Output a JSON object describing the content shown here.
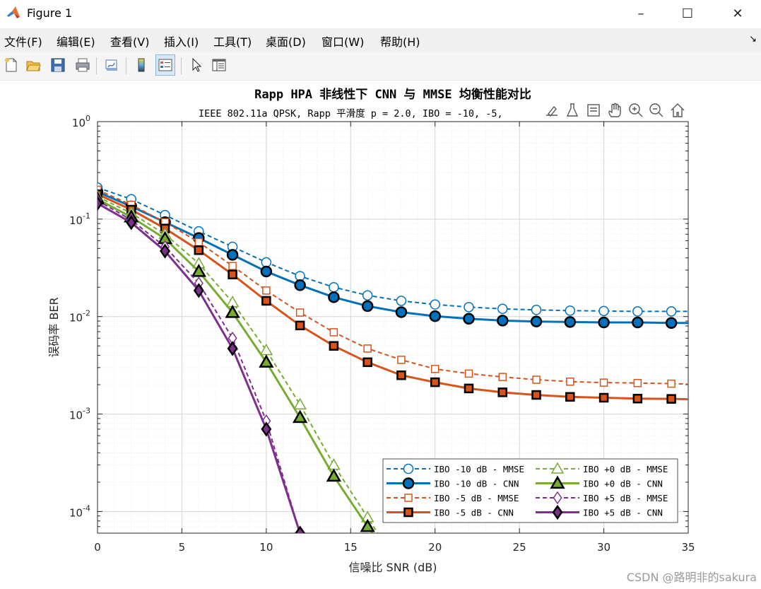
{
  "window": {
    "title": "Figure 1",
    "minimize": "–",
    "maximize": "☐",
    "close": "✕"
  },
  "menu": [
    "文件(F)",
    "编辑(E)",
    "查看(V)",
    "插入(I)",
    "工具(T)",
    "桌面(D)",
    "窗口(W)",
    "帮助(H)"
  ],
  "menu_corner": "↘",
  "toolbar_icons": [
    "new-figure-icon",
    "open-file-icon",
    "save-icon",
    "print-icon",
    "link-plot-icon",
    "colorbar-icon",
    "legend-icon",
    "pointer-icon",
    "property-inspector-icon"
  ],
  "axes_toolbar_icons": [
    "brush-icon",
    "data-tips-icon",
    "datatip-cursor-icon",
    "pan-icon",
    "zoom-in-icon",
    "zoom-out-icon",
    "home-icon"
  ],
  "watermark": "CSDN @路明非的sakura",
  "colors": {
    "blue": "#0072bd",
    "orange": "#d95319",
    "green": "#77ac30",
    "purple": "#7e2f8e"
  },
  "chart_data": {
    "type": "line",
    "title": "Rapp HPA 非线性下 CNN 与 MMSE 均衡性能对比",
    "subtitle": "IEEE 802.11a QPSK, Rapp 平滑度 p = 2.0, IBO = -10, -5,",
    "xlabel": "信噪比 SNR (dB)",
    "ylabel": "误码率 BER",
    "xlim": [
      0,
      35
    ],
    "ylim": [
      6e-05,
      1
    ],
    "yscale": "log",
    "xticks": [
      "0",
      "5",
      "10",
      "15",
      "20",
      "25",
      "30",
      "35"
    ],
    "yticks": [
      {
        "base": "10",
        "exp": "0"
      },
      {
        "base": "10",
        "exp": "-1"
      },
      {
        "base": "10",
        "exp": "-2"
      },
      {
        "base": "10",
        "exp": "-3"
      },
      {
        "base": "10",
        "exp": "-4"
      }
    ],
    "grid": "on (major and minor)",
    "legend_location": "bottom-right, 2 columns",
    "series": [
      {
        "name": "IBO -10 dB - MMSE",
        "color": "#0072bd",
        "style": "dashed",
        "marker": "circle",
        "filled": false,
        "x": [
          0,
          2,
          4,
          6,
          8,
          10,
          12,
          14,
          16,
          18,
          20,
          22,
          24,
          26,
          28,
          30,
          32,
          34,
          35
        ],
        "y": [
          0.21,
          0.16,
          0.11,
          0.075,
          0.052,
          0.036,
          0.026,
          0.02,
          0.0165,
          0.0145,
          0.0133,
          0.0125,
          0.012,
          0.0117,
          0.0115,
          0.0114,
          0.0113,
          0.0113,
          0.0113
        ]
      },
      {
        "name": "IBO -10 dB - CNN",
        "color": "#0072bd",
        "style": "solid",
        "marker": "circle",
        "filled": true,
        "x": [
          0,
          2,
          4,
          6,
          8,
          10,
          12,
          14,
          16,
          18,
          20,
          22,
          24,
          26,
          28,
          30,
          32,
          34,
          35
        ],
        "y": [
          0.19,
          0.135,
          0.093,
          0.064,
          0.043,
          0.029,
          0.021,
          0.0158,
          0.0128,
          0.0111,
          0.0101,
          0.0095,
          0.0091,
          0.0089,
          0.0088,
          0.0087,
          0.0087,
          0.0086,
          0.0086
        ]
      },
      {
        "name": "IBO -5 dB - MMSE",
        "color": "#d95319",
        "style": "dashed",
        "marker": "square",
        "filled": false,
        "x": [
          0,
          2,
          4,
          6,
          8,
          10,
          12,
          14,
          16,
          18,
          20,
          22,
          24,
          26,
          28,
          30,
          32,
          34,
          35
        ],
        "y": [
          0.2,
          0.14,
          0.093,
          0.058,
          0.033,
          0.0185,
          0.011,
          0.0069,
          0.0047,
          0.0036,
          0.0029,
          0.0026,
          0.0024,
          0.00225,
          0.00215,
          0.0021,
          0.00208,
          0.00205,
          0.00203
        ]
      },
      {
        "name": "IBO -5 dB - CNN",
        "color": "#d95319",
        "style": "solid",
        "marker": "square",
        "filled": true,
        "x": [
          0,
          2,
          4,
          6,
          8,
          10,
          12,
          14,
          16,
          18,
          20,
          22,
          24,
          26,
          28,
          30,
          32,
          34,
          35
        ],
        "y": [
          0.18,
          0.125,
          0.08,
          0.048,
          0.027,
          0.0145,
          0.0081,
          0.005,
          0.0034,
          0.0025,
          0.00212,
          0.00183,
          0.00167,
          0.00157,
          0.0015,
          0.00147,
          0.00144,
          0.00143,
          0.00142
        ]
      },
      {
        "name": "IBO +0 dB - MMSE",
        "color": "#77ac30",
        "style": "dashed",
        "marker": "triangle",
        "filled": false,
        "x": [
          0,
          2,
          4,
          6,
          8,
          10,
          12,
          14,
          16,
          16.6
        ],
        "y": [
          0.17,
          0.115,
          0.07,
          0.035,
          0.014,
          0.0045,
          0.00125,
          0.0003,
          8.7e-05,
          6e-05
        ]
      },
      {
        "name": "IBO +0 dB - CNN",
        "color": "#77ac30",
        "style": "solid",
        "marker": "triangle",
        "filled": true,
        "x": [
          0,
          2,
          4,
          6,
          8,
          10,
          12,
          14,
          16,
          16.3
        ],
        "y": [
          0.16,
          0.105,
          0.063,
          0.029,
          0.011,
          0.0034,
          0.00092,
          0.00023,
          7e-05,
          6e-05
        ]
      },
      {
        "name": "IBO +5 dB - MMSE",
        "color": "#7e2f8e",
        "style": "dashed",
        "marker": "diamond",
        "filled": false,
        "x": [
          0,
          2,
          4,
          6,
          8,
          10,
          12
        ],
        "y": [
          0.155,
          0.098,
          0.052,
          0.022,
          0.006,
          0.00085,
          6e-05
        ]
      },
      {
        "name": "IBO +5 dB - CNN",
        "color": "#7e2f8e",
        "style": "solid",
        "marker": "diamond",
        "filled": true,
        "x": [
          0,
          2,
          4,
          6,
          8,
          10,
          12
        ],
        "y": [
          0.145,
          0.092,
          0.047,
          0.0185,
          0.0047,
          0.0007,
          6e-05
        ]
      }
    ]
  }
}
